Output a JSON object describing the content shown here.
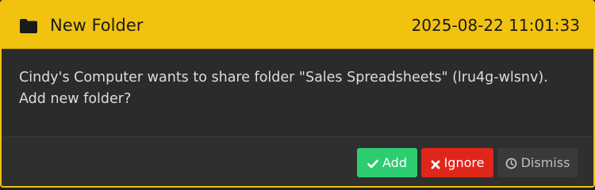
{
  "notification": {
    "title": "New Folder",
    "timestamp": "2025-08-22 11:01:33",
    "message": "Cindy's Computer wants to share folder \"Sales Spreadsheets\" (lru4g-wlsnv). Add new folder?",
    "icon": "folder-icon"
  },
  "actions": {
    "add_label": "Add",
    "add_icon": "check-icon",
    "ignore_label": "Ignore",
    "ignore_icon": "times-icon",
    "dismiss_label": "Dismiss",
    "dismiss_icon": "clock-icon"
  },
  "colors": {
    "header": "#f1c20f",
    "add": "#2ecc71",
    "ignore": "#e0261b",
    "dismiss": "#3a3a3a",
    "background": "#2b2b2b"
  }
}
